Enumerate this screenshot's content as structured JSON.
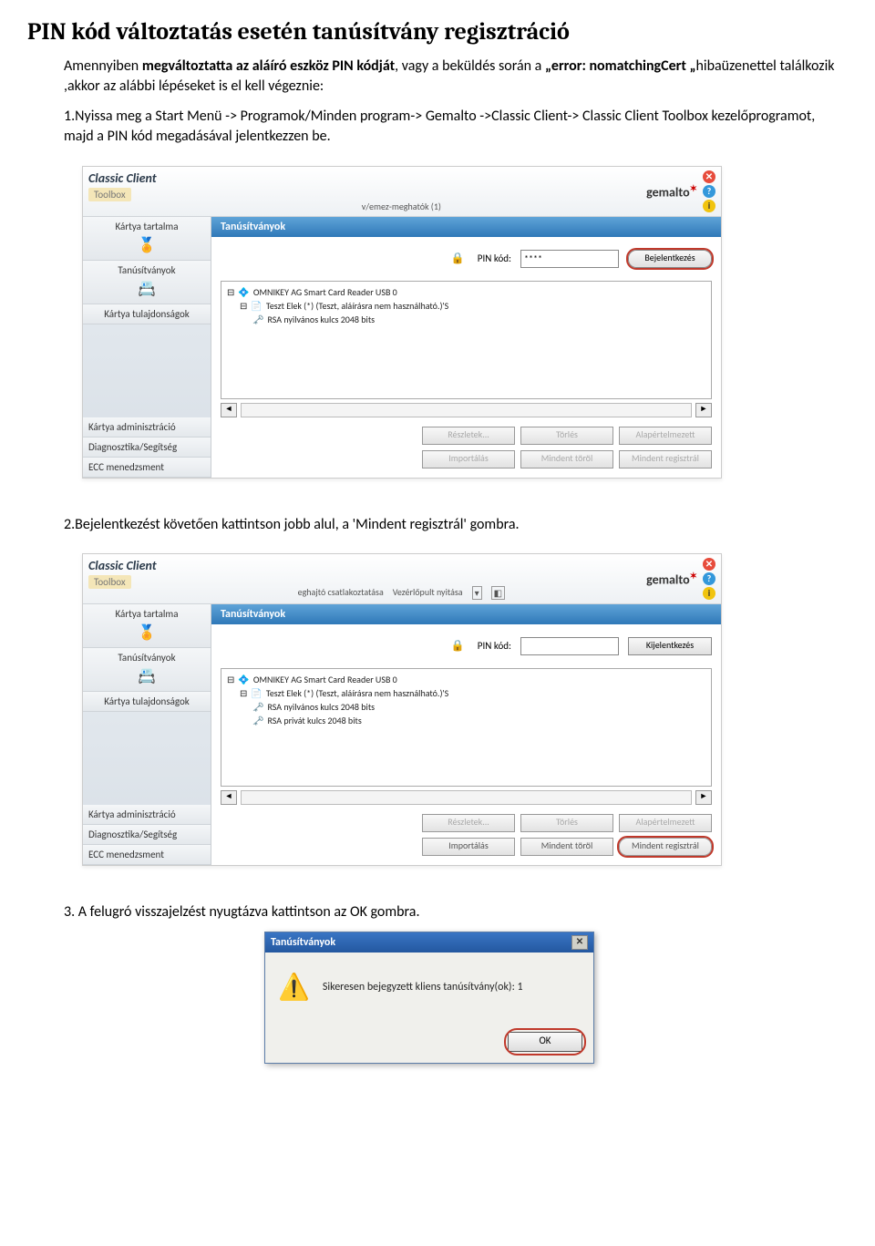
{
  "title": "PIN kód változtatás esetén tanúsítvány regisztráció",
  "intro1_a": "Amennyiben ",
  "intro1_b": "megváltoztatta az aláíró eszköz PIN kódját",
  "intro1_c": ", vagy a beküldés során a ",
  "intro1_d": "„error: nomatchingCert „",
  "intro1_e": "hibaüzenettel találkozik ,akkor az alábbi lépéseket is el kell végeznie:",
  "step1": "1.Nyissa meg a Start Menü -> Programok/Minden program-> Gemalto ->Classic Client-> Classic  Client Toolbox kezelőprogramot, majd a PIN kód megadásával jelentkezzen be.",
  "step2": "2.Bejelentkezést követően kattintson jobb alul, a 'Mindent regisztrál' gombra.",
  "step3": "3. A felugró visszajelzést nyugtázva kattintson az OK gombra.",
  "app": {
    "logo": "Classic Client",
    "toolbox": "Toolbox",
    "brand": "gemalto",
    "top_middle1": "v/emez-meghatók (1)",
    "top_middle2a": "eghajtó csatlakoztatása",
    "top_middle2b": "Vezérlőpult nyitása",
    "sidebar": {
      "s1": "Kártya tartalma",
      "s2": "Tanúsítványok",
      "s3": "Kártya tulajdonságok",
      "s4": "Kártya adminisztráció",
      "s5": "Diagnosztika/Segítség",
      "s6": "ECC menedzsment"
    },
    "tab": "Tanúsítványok",
    "pin_label": "PIN kód:",
    "pin_value": "****",
    "login_btn": "Bejelentkezés",
    "logout_btn": "Kijelentkezés",
    "tree": {
      "r1": "OMNIKEY AG Smart Card Reader USB 0",
      "r2": "Teszt Elek (*) (Teszt, aláírásra nem használható.)'S",
      "r3": "RSA nyilvános kulcs 2048 bits",
      "r4": "RSA privát kulcs 2048 bits"
    },
    "btns": {
      "b1": "Részletek...",
      "b2": "Törlés",
      "b3": "Alapértelmezett",
      "b4": "Importálás",
      "b5": "Mindent töröl",
      "b6": "Mindent regisztrál"
    }
  },
  "dialog": {
    "title": "Tanúsítványok",
    "msg": "Sikeresen bejegyzett kliens tanúsítvány(ok): 1",
    "ok": "OK"
  }
}
